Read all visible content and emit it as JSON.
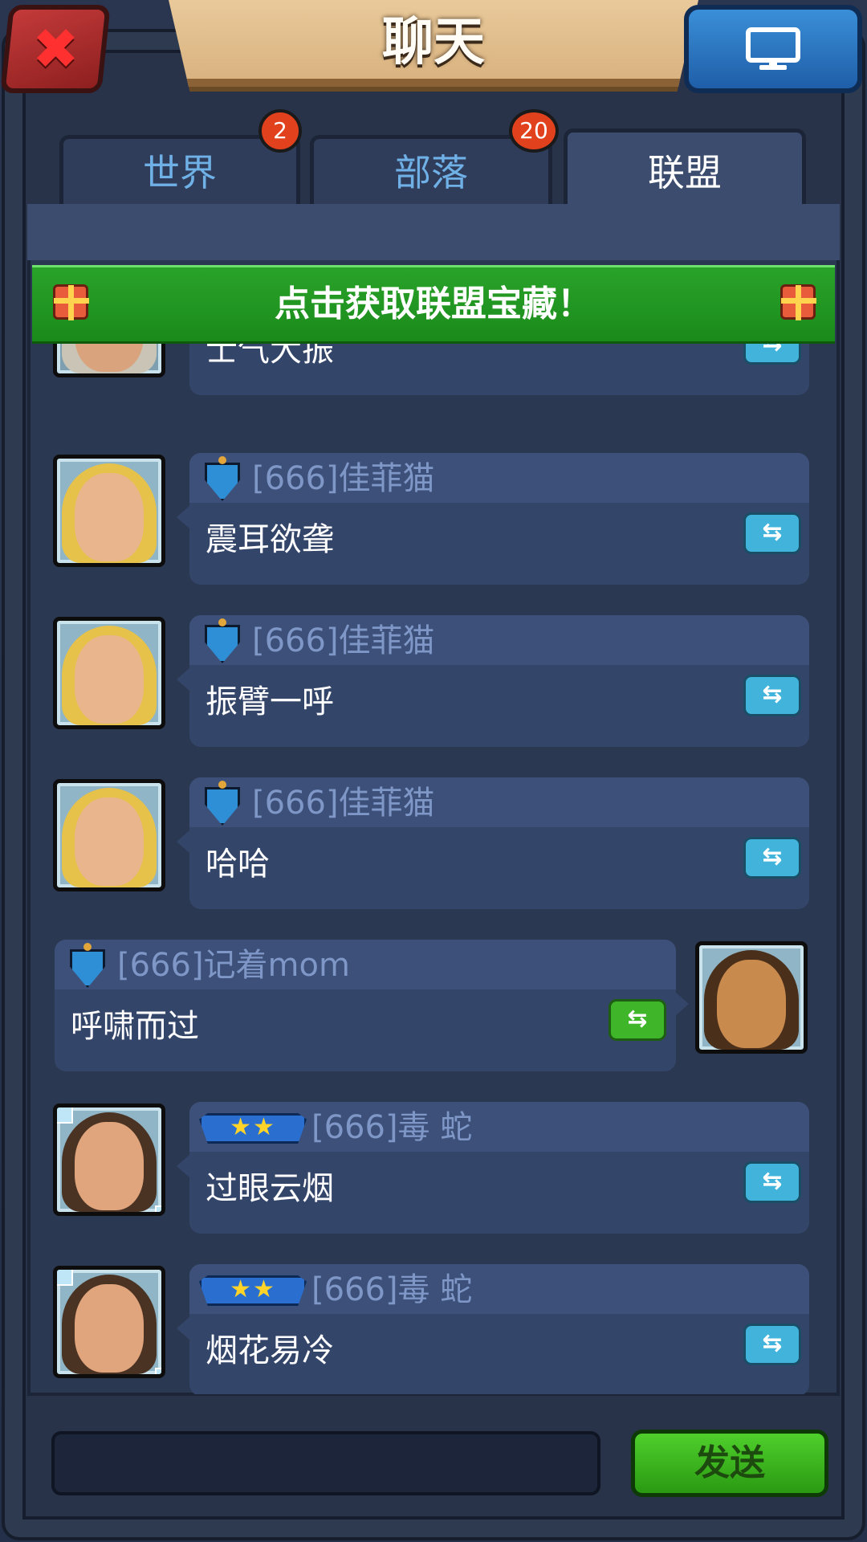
{
  "header": {
    "title": "聊天",
    "close_icon": "close-x-icon",
    "screen_icon": "monitor-icon"
  },
  "tabs": [
    {
      "label": "世界",
      "badge": "2",
      "active": false
    },
    {
      "label": "部落",
      "badge": "20",
      "active": false
    },
    {
      "label": "联盟",
      "badge": "",
      "active": true
    }
  ],
  "banner": {
    "text": "点击获取联盟宝藏！",
    "icon": "gift-icon"
  },
  "messages": [
    {
      "side": "left",
      "name": "",
      "text": "士气大振",
      "avatar": "hooded-warrior"
    },
    {
      "side": "left",
      "name": "[666]佳菲猫",
      "text": "震耳欲聋",
      "avatar": "blonde-woman"
    },
    {
      "side": "left",
      "name": "[666]佳菲猫",
      "text": "振臂一呼",
      "avatar": "blonde-woman"
    },
    {
      "side": "left",
      "name": "[666]佳菲猫",
      "text": "哈哈",
      "avatar": "blonde-woman"
    },
    {
      "side": "right",
      "name": "[666]记着mom",
      "text": "呼啸而过",
      "avatar": "bearded-man"
    },
    {
      "side": "left",
      "name": "[666]毒 蛇",
      "text": "过眼云烟",
      "avatar": "brunette-woman",
      "rank": "★★"
    },
    {
      "side": "left",
      "name": "[666]毒 蛇",
      "text": "烟花易冷",
      "avatar": "brunette-woman",
      "rank": "★★"
    }
  ],
  "translate_symbol": "⇆",
  "input": {
    "placeholder": ""
  },
  "send_label": "发送",
  "colors": {
    "accent_green": "#2aa32a",
    "name_blue": "#7e97c7",
    "badge_red": "#e2411d"
  }
}
